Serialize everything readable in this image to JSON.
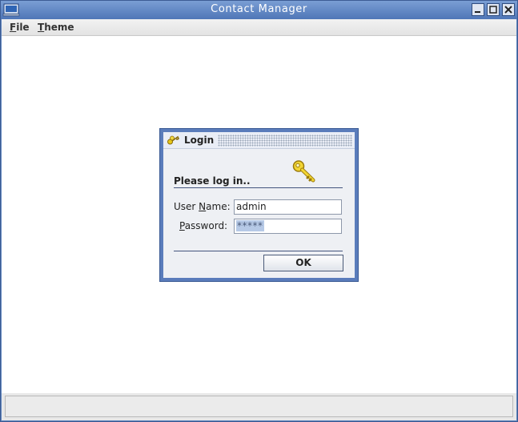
{
  "window": {
    "title": "Contact Manager",
    "icon": "app-window-icon",
    "controls": [
      "minimize-icon",
      "maximize-icon",
      "close-icon"
    ]
  },
  "menubar": {
    "file": {
      "mnemonic": "F",
      "rest": "ile"
    },
    "theme": {
      "mnemonic": "T",
      "rest": "heme"
    }
  },
  "status": {
    "text": ""
  },
  "dialog": {
    "title": "Login",
    "title_icon": "keys-icon",
    "header": "Please log in..",
    "header_icon": "key-icon",
    "username": {
      "label_pre": "User ",
      "mnemonic": "N",
      "label_post": "ame:",
      "value": "admin"
    },
    "password": {
      "mnemonic": "P",
      "label_post": "assword:",
      "value": "*****"
    },
    "ok_label": "OK"
  },
  "colors": {
    "accent": "#5a7cbb",
    "title_bar": "#5f84bd",
    "key": "#e6c619"
  }
}
